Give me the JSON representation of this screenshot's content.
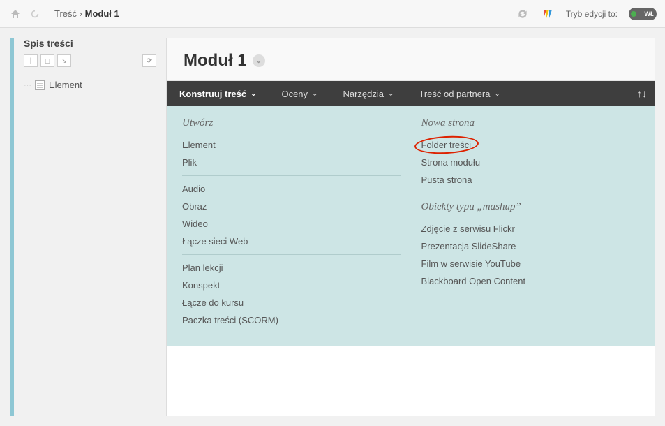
{
  "breadcrumb": {
    "root": "Treść",
    "current": "Moduł 1"
  },
  "edit_mode": {
    "label": "Tryb edycji to:",
    "state": "Wł."
  },
  "sidebar": {
    "title": "Spis treści",
    "items": [
      {
        "label": "Element"
      }
    ]
  },
  "page_title": "Moduł 1",
  "menubar": [
    {
      "label": "Konstruuj treść",
      "active": true
    },
    {
      "label": "Oceny"
    },
    {
      "label": "Narzędzia"
    },
    {
      "label": "Treść od partnera"
    }
  ],
  "dropdown": {
    "col1": {
      "heading": "Utwórz",
      "groups": [
        [
          "Element",
          "Plik"
        ],
        [
          "Audio",
          "Obraz",
          "Wideo",
          "Łącze sieci Web"
        ],
        [
          "Plan lekcji",
          "Konspekt",
          "Łącze do kursu",
          "Paczka treści (SCORM)"
        ]
      ]
    },
    "col2a": {
      "heading": "Nowa strona",
      "items": [
        "Folder treści",
        "Strona modułu",
        "Pusta strona"
      ]
    },
    "col2b": {
      "heading": "Obiekty typu „mashup”",
      "items": [
        "Zdjęcie z serwisu Flickr",
        "Prezentacja SlideShare",
        "Film w serwisie YouTube",
        "Blackboard Open Content"
      ]
    }
  }
}
